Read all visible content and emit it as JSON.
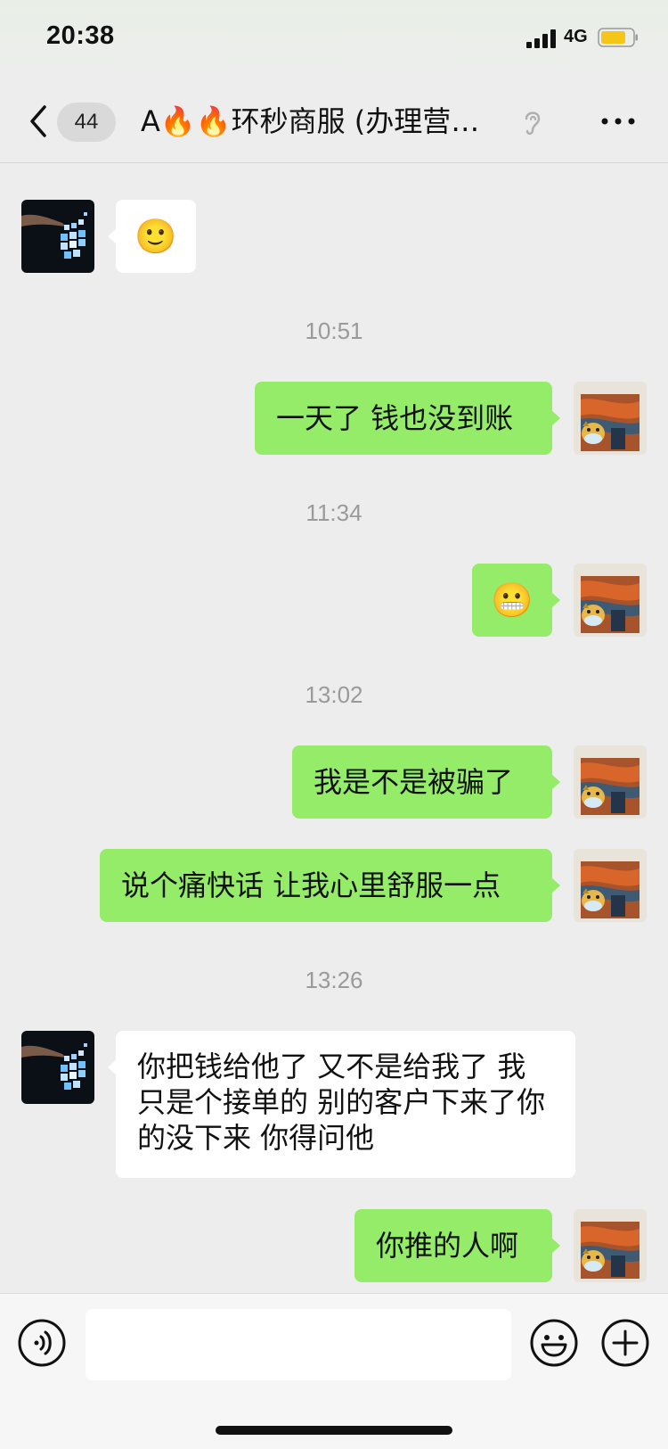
{
  "status_bar": {
    "time": "20:38",
    "network": "4G",
    "battery_color": "#f5c518"
  },
  "nav": {
    "unread_count": "44",
    "title": "A🔥🔥环秒商服 (办理营…",
    "back_icon": "chevron-left-icon",
    "ear_icon": "ear-icon",
    "more_icon": "more-dots-icon"
  },
  "messages": [
    {
      "side": "in",
      "type": "emoji",
      "text": "🙂"
    },
    {
      "type": "time",
      "text": "10:51"
    },
    {
      "side": "out",
      "type": "text",
      "text": "一天了 钱也没到账"
    },
    {
      "type": "time",
      "text": "11:34"
    },
    {
      "side": "out",
      "type": "emoji",
      "text": "😬"
    },
    {
      "type": "time",
      "text": "13:02"
    },
    {
      "side": "out",
      "type": "text",
      "text": "我是不是被骗了"
    },
    {
      "side": "out",
      "type": "text",
      "text": "说个痛快话 让我心里舒服一点"
    },
    {
      "type": "time",
      "text": "13:26"
    },
    {
      "side": "in",
      "type": "text",
      "text": "你把钱给他了 又不是给我了 我只是个接单的 别的客户下来了你的没下来 你得问他"
    },
    {
      "side": "out",
      "type": "text",
      "text": "你推的人啊"
    }
  ],
  "avatars": {
    "contact": "contact-avatar-tech-hand",
    "self": "munch-scream-avatar",
    "self_label": "MUNCH"
  },
  "input_bar": {
    "value": "",
    "voice_icon": "voice-icon",
    "emoji_icon": "emoji-icon",
    "plus_icon": "plus-icon"
  },
  "colors": {
    "background": "#ededed",
    "outgoing_bubble": "#95ec69",
    "incoming_bubble": "#ffffff"
  }
}
